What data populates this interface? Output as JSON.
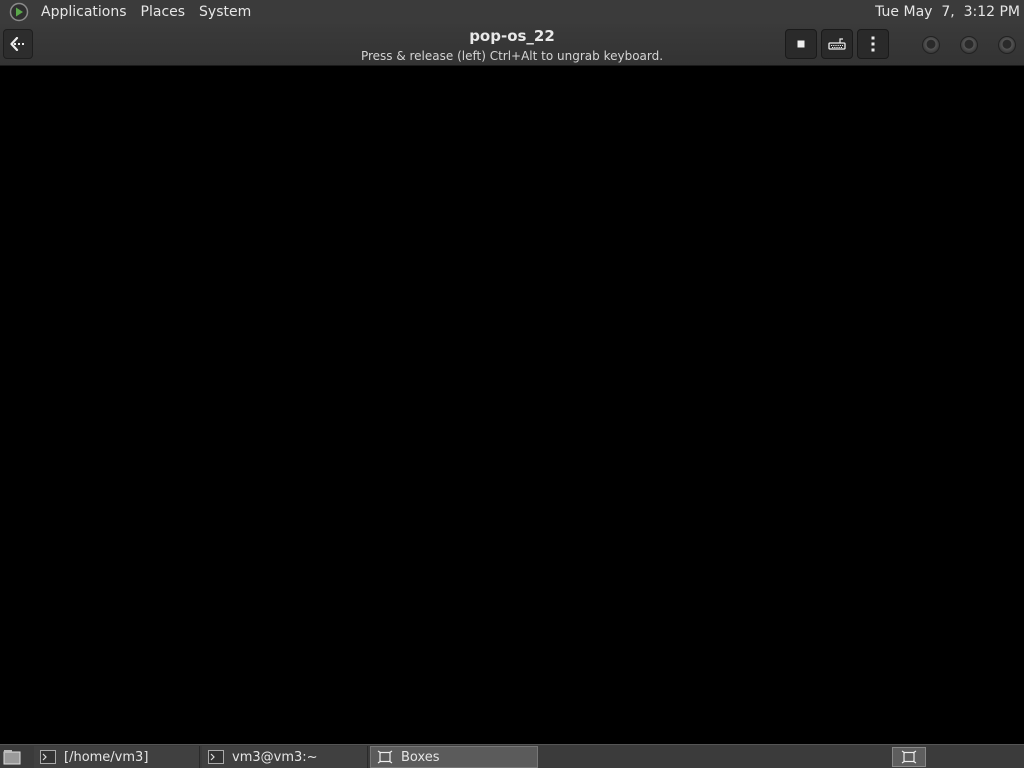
{
  "top_panel": {
    "menus": [
      "Applications",
      "Places",
      "System"
    ],
    "clock": "Tue May  7,  3:12 PM"
  },
  "window": {
    "title": "pop-os_22",
    "subtitle": "Press & release (left) Ctrl+Alt to ungrab keyboard.",
    "buttons": {
      "back_icon": "arrow-left-icon",
      "stop_icon": "stop-icon",
      "keys_icon": "keyboard-icon",
      "menu_icon": "kebab-menu-icon"
    }
  },
  "taskbar": {
    "tasks": [
      {
        "label": "[/home/vm3]",
        "icon": "terminal-icon",
        "active": false
      },
      {
        "label": "vm3@vm3:~",
        "icon": "terminal-icon",
        "active": false
      },
      {
        "label": "Boxes",
        "icon": "boxes-icon",
        "active": true
      }
    ]
  },
  "colors": {
    "panel_bg": "#3b3b3b",
    "header_bg": "#353535",
    "vm_bg": "#000000",
    "text": "#e6e6e6"
  }
}
